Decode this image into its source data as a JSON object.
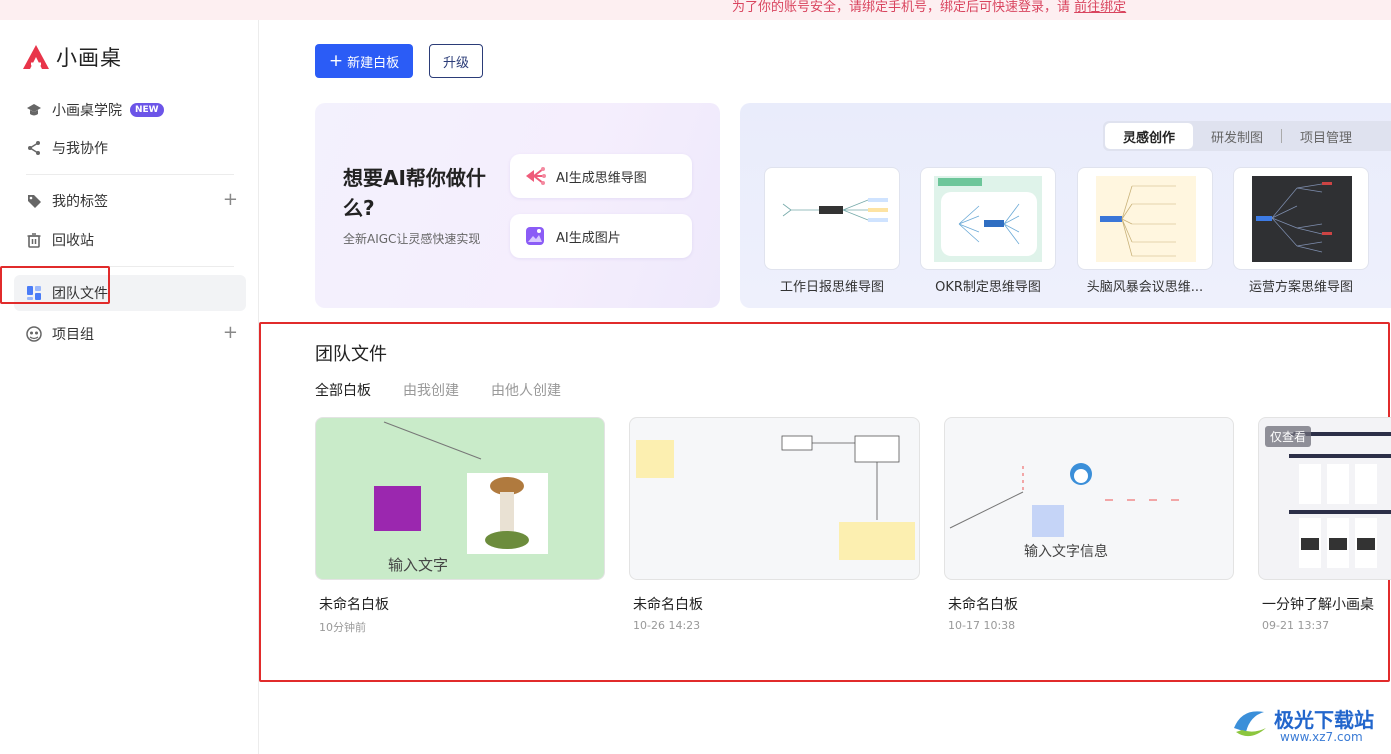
{
  "notice": {
    "text": "为了你的账号安全，请绑定手机号，绑定后可快速登录，请",
    "link": "前往绑定"
  },
  "app": {
    "name": "小画桌",
    "brand_color": "#e8354a"
  },
  "sidebar": {
    "academy": "小画桌学院",
    "academy_badge": "NEW",
    "collab": "与我协作",
    "tags": "我的标签",
    "trash": "回收站",
    "team": "团队文件",
    "projects": "项目组"
  },
  "toolbar": {
    "new_board": "新建白板",
    "upgrade": "升级"
  },
  "ai": {
    "title": "想要AI帮你做什么?",
    "subtitle": "全新AIGC让灵感快速实现",
    "mindmap": "AI生成思维导图",
    "image": "AI生成图片"
  },
  "templates": {
    "tabs": [
      "灵感创作",
      "研发制图",
      "项目管理"
    ],
    "items": [
      "工作日报思维导图",
      "OKR制定思维导图",
      "头脑风暴会议思维...",
      "运营方案思维导图"
    ]
  },
  "team": {
    "title": "团队文件",
    "filters": [
      "全部白板",
      "由我创建",
      "由他人创建"
    ],
    "files": [
      {
        "name": "未命名白板",
        "time": "10分钟前",
        "thumb_text": "输入文字"
      },
      {
        "name": "未命名白板",
        "time": "10-26 14:23"
      },
      {
        "name": "未命名白板",
        "time": "10-17 10:38",
        "thumb_text": "输入文字信息"
      },
      {
        "name": "一分钟了解小画桌",
        "time": "09-21 13:37",
        "badge": "仅查看"
      }
    ]
  },
  "watermark": {
    "line1": "极光下载站",
    "line2": "www.xz7.com"
  }
}
